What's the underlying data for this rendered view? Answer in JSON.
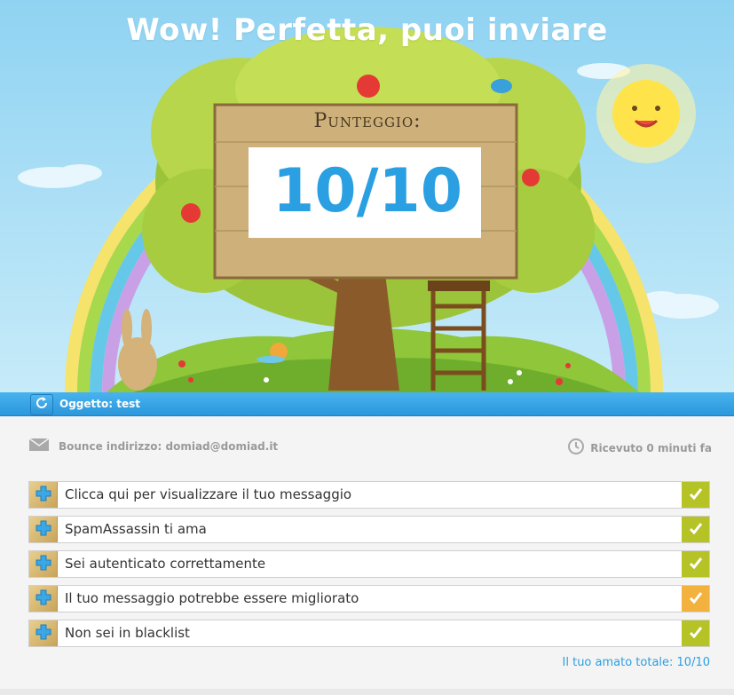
{
  "hero": {
    "title": "Wow! Perfetta, puoi inviare",
    "score_label": "Punteggio:",
    "score_value": "10/10"
  },
  "subject_bar": {
    "refresh_icon": "refresh-icon",
    "subject": "Oggetto: test"
  },
  "meta": {
    "bounce_icon": "envelope-icon",
    "bounce": "Bounce indirizzo: domiad@domiad.it",
    "received_icon": "clock-icon",
    "received": "Ricevuto 0 minuti fa"
  },
  "checks": [
    {
      "label": "Clicca qui per visualizzare il tuo messaggio",
      "status": "ok",
      "status_color": "#b5c327"
    },
    {
      "label": "SpamAssassin ti ama",
      "status": "ok",
      "status_color": "#b5c327"
    },
    {
      "label": "Sei autenticato correttamente",
      "status": "ok",
      "status_color": "#b5c327"
    },
    {
      "label": "Il tuo messaggio potrebbe essere migliorato",
      "status": "warning",
      "status_color": "#f3b23e"
    },
    {
      "label": "Non sei in blacklist",
      "status": "ok",
      "status_color": "#b5c327"
    }
  ],
  "total": "Il tuo amato totale: 10/10",
  "colors": {
    "accent": "#2a9fe1",
    "ok": "#b5c327",
    "warning": "#f3b23e"
  }
}
